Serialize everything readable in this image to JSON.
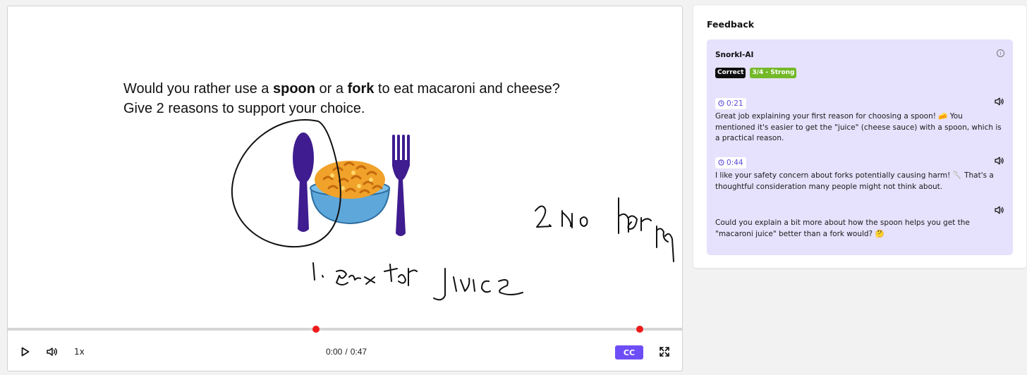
{
  "player": {
    "question_line1": {
      "pre": "Would you rather use a ",
      "b1": "spoon",
      "mid": " or a ",
      "b2": "fork",
      "post": " to eat macaroni and cheese?"
    },
    "question_line2": "Give 2 reasons to support your choice.",
    "seek_markers": [
      0.456,
      0.935
    ],
    "controls": {
      "speed": "1x",
      "time_current": "0:00",
      "time_sep": "/",
      "time_total": "0:47",
      "cc_label": "CC"
    },
    "icons": [
      "play-icon",
      "volume-icon",
      "fullscreen-icon"
    ],
    "accent_color": "#6d4ef6",
    "marker_color": "#ef1a1a"
  },
  "feedback": {
    "title": "Feedback",
    "card": {
      "name": "Snorkl-AI",
      "badges": [
        "Correct",
        "3/4 - Strong"
      ],
      "badge_colors": [
        "#0e0e0e",
        "#73b928"
      ],
      "items": [
        {
          "timestamp": "0:21",
          "text": "Great job explaining your first reason for choosing a spoon! 🧀 You mentioned it's easier to get the \"juice\" (cheese sauce) with a spoon, which is a practical reason."
        },
        {
          "timestamp": "0:44",
          "text": "I like your safety concern about forks potentially causing harm! 🥄 That's a thoughtful consideration many people might not think about."
        },
        {
          "timestamp": "",
          "text": "Could you explain a bit more about how the spoon helps you get the \"macaroni juice\" better than a fork would? 🤔"
        }
      ]
    },
    "background": "#e6e1fc"
  }
}
